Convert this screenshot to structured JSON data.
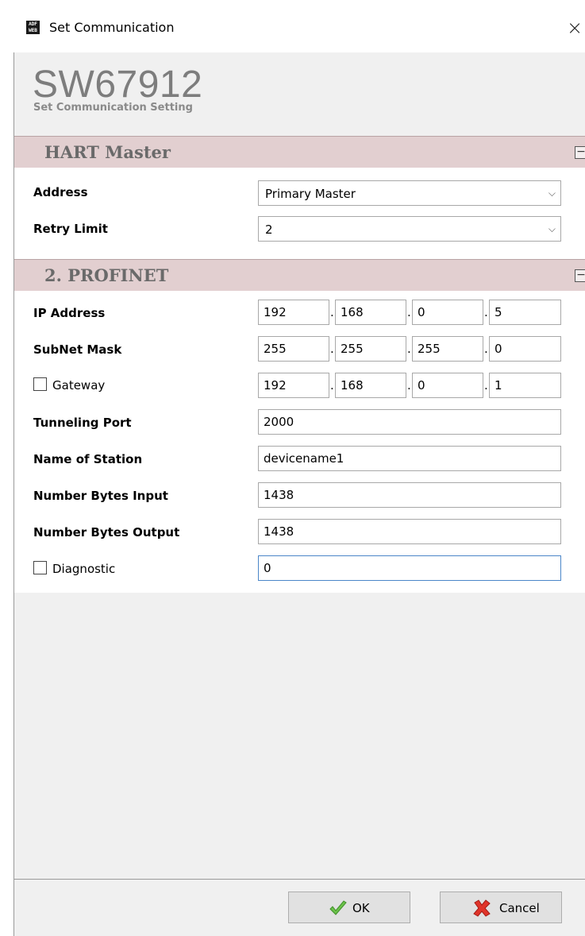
{
  "window": {
    "title": "Set Communication",
    "icon_text": "ADF WEB",
    "close_glyph": "×"
  },
  "header": {
    "product_code": "SW67912",
    "subtitle": "Set Communication Setting"
  },
  "hart_master": {
    "title": "HART Master",
    "collapse_glyph": "−",
    "address_label": "Address",
    "address_value": "Primary Master",
    "retry_label": "Retry Limit",
    "retry_value": "2",
    "dropdown_glyph": "⌵"
  },
  "profinet": {
    "title": "2. PROFINET",
    "collapse_glyph": "−",
    "ip_label": "IP Address",
    "ip": [
      "192",
      "168",
      "0",
      "5"
    ],
    "subnet_label": "SubNet Mask",
    "subnet": [
      "255",
      "255",
      "255",
      "0"
    ],
    "gateway_label": "Gateway",
    "gateway_checked": false,
    "gateway": [
      "192",
      "168",
      "0",
      "1"
    ],
    "tunneling_label": "Tunneling Port",
    "tunneling_value": "2000",
    "station_label": "Name of Station",
    "station_value": "devicename1",
    "bytes_in_label": "Number Bytes Input",
    "bytes_in_value": "1438",
    "bytes_out_label": "Number Bytes Output",
    "bytes_out_value": "1438",
    "diagnostic_label": "Diagnostic",
    "diagnostic_checked": false,
    "diagnostic_value": "0",
    "ip_separator": "."
  },
  "footer": {
    "ok_label": "OK",
    "cancel_label": "Cancel"
  },
  "colors": {
    "section_bar": "#e2cfd0",
    "ok_icon": "#6cc24a",
    "cancel_icon": "#e0342a",
    "focus_border": "#4b86c8"
  },
  "icons": {
    "window_icon": "adfweb-logo-icon",
    "ok_icon": "check-icon",
    "cancel_icon": "cross-icon",
    "collapse_icon": "minus-box-icon"
  }
}
